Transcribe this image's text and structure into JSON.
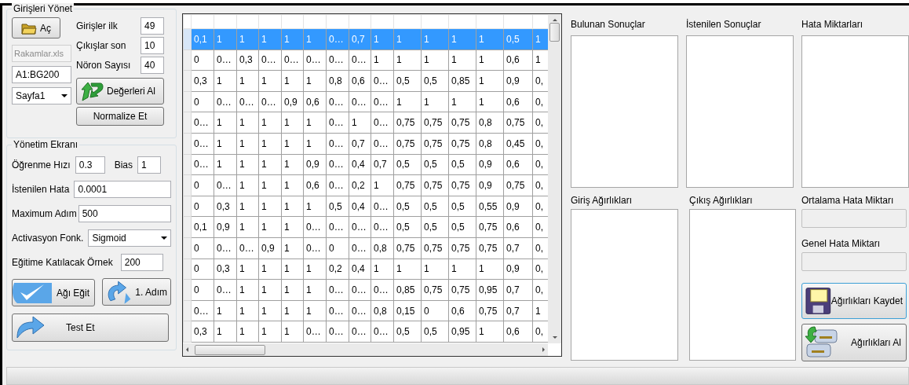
{
  "input_group": {
    "title": "Girişleri Yönet",
    "open_button": "Aç",
    "file_field": {
      "value": "Rakamlar.xls",
      "disabled": true
    },
    "range_field": {
      "value": "A1:BG200"
    },
    "sheet_select": {
      "value": "Sayfa1"
    },
    "params": [
      {
        "label": "Girişler ilk",
        "value": "49"
      },
      {
        "label": "Çıkışlar son",
        "value": "10"
      },
      {
        "label": "Nöron Sayısı",
        "value": "40"
      }
    ],
    "get_values_button": "Değerleri Al",
    "normalize_button": "Normalize Et"
  },
  "control_group": {
    "title": "Yönetim Ekranı",
    "learning_rate": {
      "label": "Öğrenme Hızı",
      "value": "0.3"
    },
    "bias": {
      "label": "Bias",
      "value": "1"
    },
    "target_error": {
      "label": "İstenilen Hata",
      "value": "0.0001"
    },
    "max_steps": {
      "label": "Maximum Adım",
      "value": "500"
    },
    "activation": {
      "label": "Activasyon Fonk.",
      "value": "Sigmoid"
    },
    "training_samples": {
      "label": "Eğitime Katılacak Örnek",
      "value": "200"
    },
    "train_button": "Ağı Eğit",
    "step_button": "1. Adım",
    "test_button": "Test Et"
  },
  "table": {
    "rows": [
      {
        "selected": true,
        "cells": [
          "0,1",
          "1",
          "1",
          "1",
          "1",
          "1",
          "0…",
          "0,7",
          "1",
          "1",
          "1",
          "1",
          "1",
          "0,5",
          "1"
        ]
      },
      {
        "selected": false,
        "cells": [
          "0",
          "0…",
          "0,3",
          "0…",
          "0…",
          "0…",
          "0…",
          "0…",
          "1",
          "1",
          "1",
          "1",
          "1",
          "0,6",
          "1"
        ]
      },
      {
        "selected": false,
        "cells": [
          "0,3",
          "1",
          "1",
          "1",
          "1",
          "1",
          "0,8",
          "0,6",
          "0…",
          "0,5",
          "0,5",
          "0,85",
          "1",
          "0,9",
          "0,"
        ]
      },
      {
        "selected": false,
        "cells": [
          "0",
          "0…",
          "0…",
          "0…",
          "0,9",
          "0,6",
          "0…",
          "0…",
          "0…",
          "1",
          "1",
          "1",
          "1",
          "0,6",
          "0,"
        ]
      },
      {
        "selected": false,
        "cells": [
          "0…",
          "1",
          "1",
          "1",
          "1",
          "1",
          "0…",
          "1",
          "0…",
          "0,75",
          "0,75",
          "0,75",
          "0,8",
          "0,75",
          "0,"
        ]
      },
      {
        "selected": false,
        "cells": [
          "0…",
          "1",
          "1",
          "1",
          "1",
          "1",
          "0…",
          "0,7",
          "0…",
          "0,75",
          "0,75",
          "0,75",
          "0,8",
          "0,45",
          "0,"
        ]
      },
      {
        "selected": false,
        "cells": [
          "0…",
          "1",
          "1",
          "1",
          "1",
          "0,9",
          "0…",
          "0,4",
          "0,7",
          "0,5",
          "0,5",
          "0,5",
          "0,9",
          "0,6",
          "0,"
        ]
      },
      {
        "selected": false,
        "cells": [
          "0",
          "0…",
          "1",
          "1",
          "1",
          "0,6",
          "0…",
          "0,2",
          "1",
          "0,75",
          "0,75",
          "0,75",
          "0,9",
          "0,75",
          "0,"
        ]
      },
      {
        "selected": false,
        "cells": [
          "0",
          "0,3",
          "1",
          "1",
          "1",
          "1",
          "0,5",
          "0,4",
          "0…",
          "0,5",
          "0,5",
          "0,5",
          "0,55",
          "0,9",
          "0,"
        ]
      },
      {
        "selected": false,
        "cells": [
          "0,1",
          "0,9",
          "1",
          "1",
          "1",
          "0…",
          "0…",
          "0…",
          "0…",
          "0,5",
          "0,5",
          "0,5",
          "0,75",
          "0,6",
          "0,"
        ]
      },
      {
        "selected": false,
        "cells": [
          "0",
          "0…",
          "0…",
          "0,9",
          "1",
          "0…",
          "0",
          "0…",
          "0,8",
          "0,75",
          "0,75",
          "0,75",
          "0,75",
          "0,7",
          "0,"
        ]
      },
      {
        "selected": false,
        "cells": [
          "0",
          "0,3",
          "1",
          "1",
          "1",
          "1",
          "0,2",
          "0,4",
          "1",
          "1",
          "1",
          "1",
          "1",
          "0,9",
          "0,"
        ]
      },
      {
        "selected": false,
        "cells": [
          "0",
          "0…",
          "1",
          "1",
          "1",
          "1",
          "0…",
          "0…",
          "0…",
          "0,85",
          "0,75",
          "0,75",
          "0,95",
          "0,7",
          "0,"
        ]
      },
      {
        "selected": false,
        "cells": [
          "0…",
          "1",
          "1",
          "1",
          "1",
          "1",
          "0…",
          "0…",
          "0,8",
          "0,15",
          "0",
          "0,6",
          "0,75",
          "0,7",
          "1"
        ]
      },
      {
        "selected": false,
        "cells": [
          "0,3",
          "1",
          "1",
          "1",
          "1",
          "0…",
          "0…",
          "0…",
          "0…",
          "0,5",
          "0,5",
          "0,95",
          "1",
          "0,6",
          "0,"
        ]
      }
    ]
  },
  "result_lists": [
    {
      "label": "Bulunan Sonuçlar"
    },
    {
      "label": "İstenilen Sonuçlar"
    },
    {
      "label": "Hata Miktarları"
    }
  ],
  "weight_lists": [
    {
      "label": "Giriş Ağırlıkları"
    },
    {
      "label": "Çıkış Ağırlıkları"
    }
  ],
  "error_fields": [
    {
      "label": "Ortalama Hata Miktarı"
    },
    {
      "label": "Genel Hata Miktarı"
    }
  ],
  "save_button": "Ağırlıkları Kaydet",
  "load_button": "Ağırlıkları Al"
}
